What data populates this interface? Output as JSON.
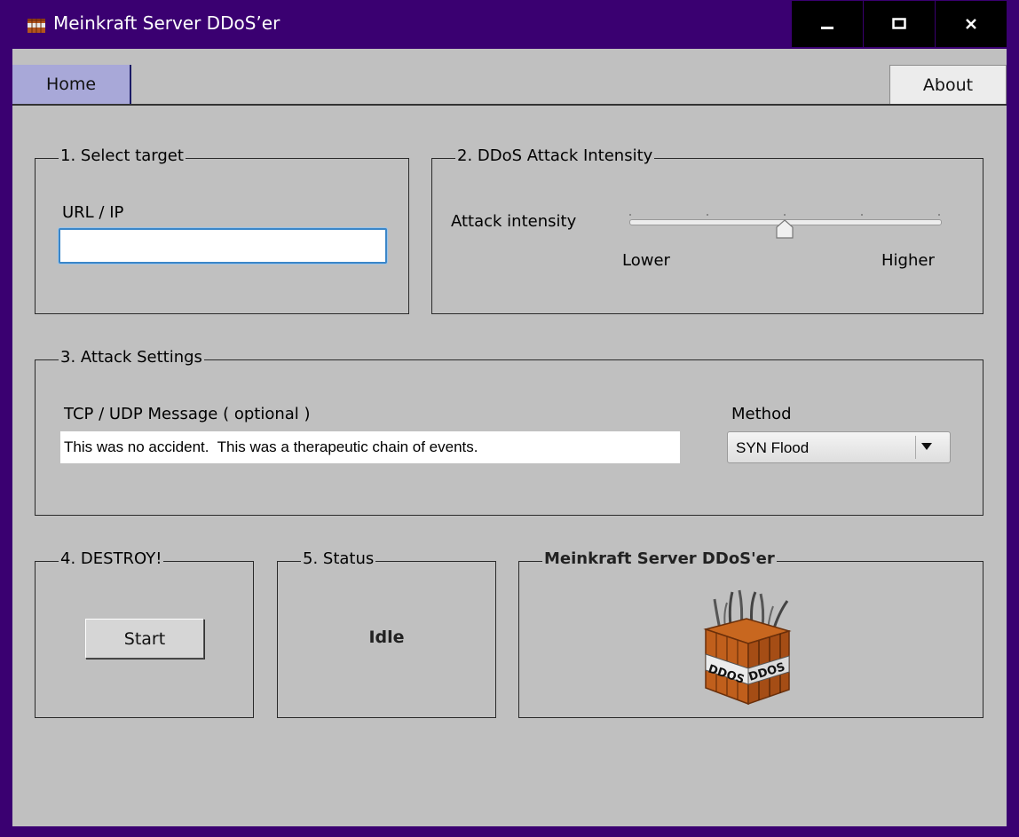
{
  "window": {
    "title": "Meinkraft Server DDoS’er",
    "minimize_icon": "minimize-icon",
    "maximize_icon": "maximize-icon",
    "close_icon": "close-icon"
  },
  "tabs": [
    {
      "label": "Home",
      "active": true
    },
    {
      "label": "About",
      "active": false
    }
  ],
  "target": {
    "group_title": "1. Select target",
    "url_label": "URL / IP",
    "url_value": ""
  },
  "intensity": {
    "group_title": "2. DDoS Attack Intensity",
    "label": "Attack intensity",
    "low_label": "Lower",
    "high_label": "Higher",
    "level": 0.5
  },
  "settings": {
    "group_title": "3. Attack Settings",
    "message_label": "TCP / UDP Message  ( optional )",
    "message_value": "This was no accident.  This was a therapeutic chain of events.",
    "method_label": "Method",
    "method_value": "SYN Flood"
  },
  "destroy": {
    "group_title": "4. DESTROY!",
    "start_label": "Start"
  },
  "status": {
    "group_title": "5. Status",
    "value": "Idle"
  },
  "branding": {
    "group_title": "Meinkraft Server DDoS'er",
    "logo_text": "DDOS"
  },
  "colors": {
    "frame": "#3a0071",
    "client_bg": "#c0c0c0",
    "active_tab": "#a8a8d8"
  }
}
